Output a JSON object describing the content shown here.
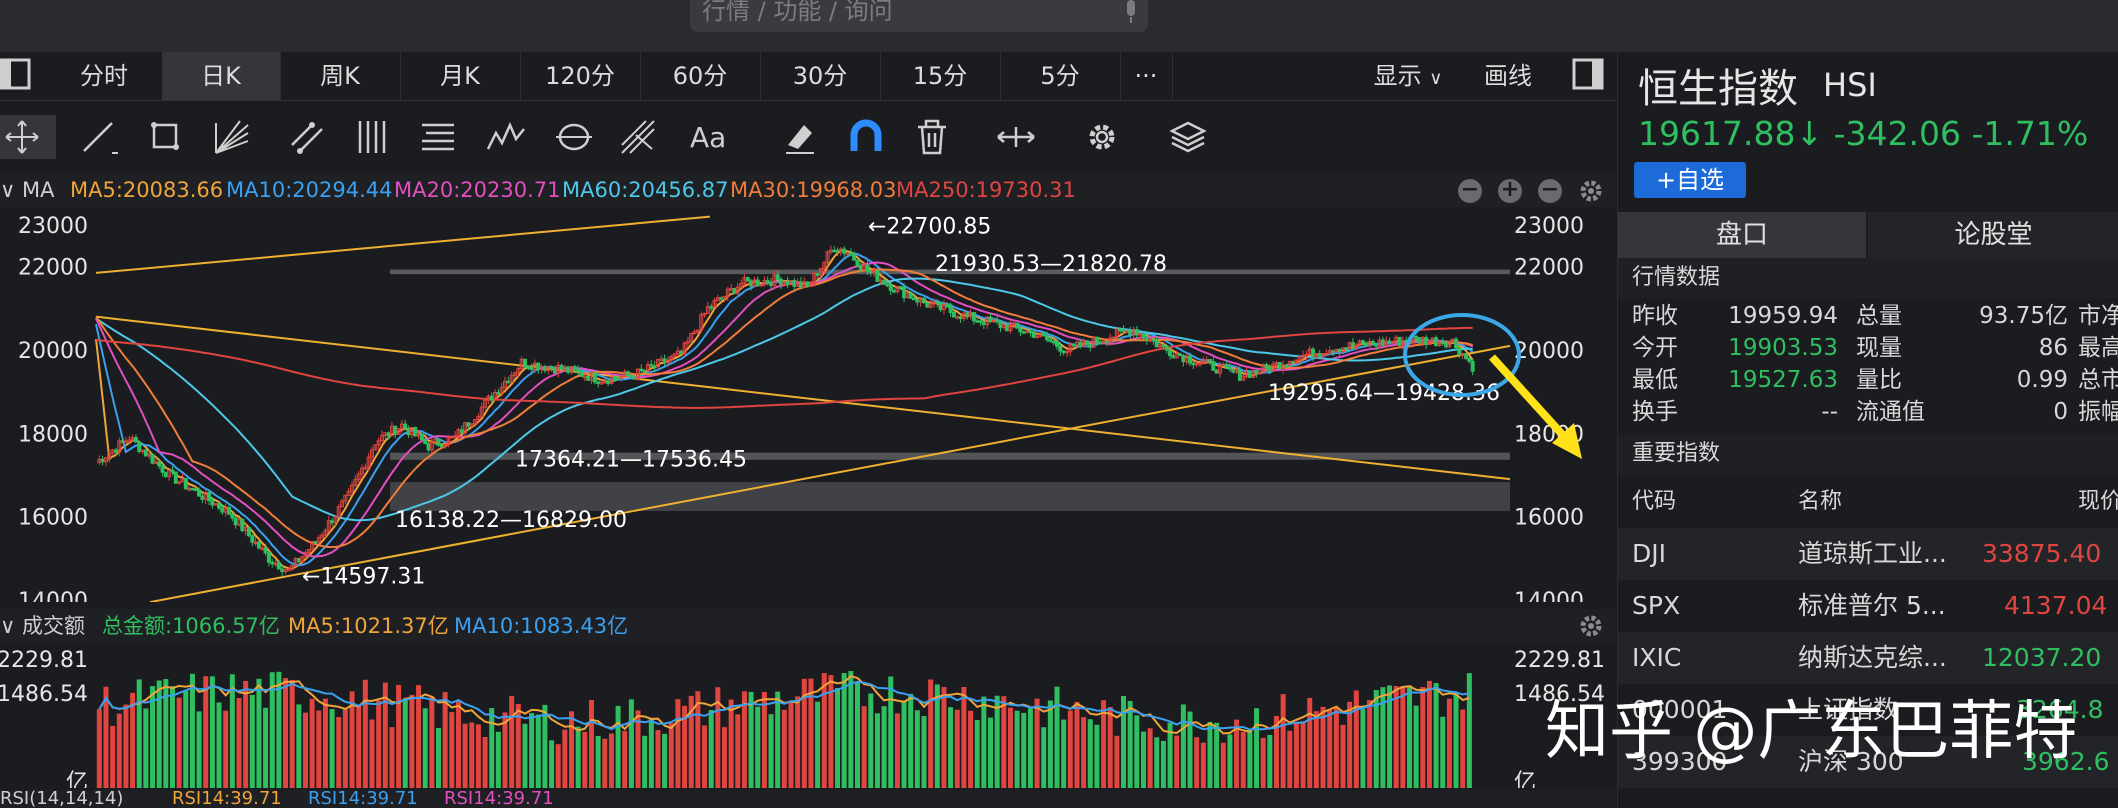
{
  "search": {
    "placeholder": "行情 / 功能 / 询问"
  },
  "tabs": [
    {
      "label": "分时",
      "active": false
    },
    {
      "label": "日K",
      "active": true
    },
    {
      "label": "周K",
      "active": false
    },
    {
      "label": "月K",
      "active": false
    },
    {
      "label": "120分",
      "active": false
    },
    {
      "label": "60分",
      "active": false
    },
    {
      "label": "30分",
      "active": false
    },
    {
      "label": "15分",
      "active": false
    },
    {
      "label": "5分",
      "active": false
    },
    {
      "label": "···",
      "active": false
    }
  ],
  "tabs_right": {
    "display": "显示",
    "draw": "画线"
  },
  "tools": [
    "move-icon",
    "line-icon",
    "rectangle-icon",
    "fan-icon",
    "channel-icon",
    "parallel-lines-icon",
    "fibonacci-icon",
    "wave-icon",
    "cycle-icon",
    "pitchfork-icon",
    "text-icon",
    "eraser-icon",
    "magnet-icon",
    "trash-icon",
    "arrows-icon",
    "settings-icon",
    "layers-icon"
  ],
  "ma": {
    "label": "MA",
    "items": [
      {
        "text": "MA5:20083.66",
        "color": "#f0a43a"
      },
      {
        "text": "MA10:20294.44",
        "color": "#3aa0f0"
      },
      {
        "text": "MA20:20230.71",
        "color": "#e24fc0"
      },
      {
        "text": "MA60:20456.87",
        "color": "#4cc8e8"
      },
      {
        "text": "MA30:19968.03",
        "color": "#f07d3a"
      },
      {
        "text": "MA250:19730.31",
        "color": "#e0453f"
      }
    ]
  },
  "chart_data": {
    "type": "candlestick",
    "y_ticks_left": [
      "23000",
      "22000",
      "20000",
      "18000",
      "16000",
      "14000"
    ],
    "y_ticks_right": [
      "23000",
      "22000",
      "20000",
      "18000",
      "16000",
      "14000"
    ],
    "annotations": [
      {
        "text": "←22700.85"
      },
      {
        "text": "21930.53—21820.78"
      },
      {
        "text": "17364.21—17536.45"
      },
      {
        "text": "16138.22—16829.00"
      },
      {
        "text": "←14597.31"
      },
      {
        "text": "19295.64—19428.36"
      }
    ],
    "ylim": [
      14000,
      23000
    ]
  },
  "volume": {
    "label": "成交额",
    "total": "总金额:1066.57亿",
    "ma5": "MA5:1021.37亿",
    "ma10": "MA10:1083.43亿",
    "ticks_left": [
      "2229.81",
      "1486.54",
      "亿"
    ],
    "ticks_right": [
      "2229.81",
      "1486.54",
      "亿"
    ]
  },
  "rsi": {
    "label": "RSI(14,14,14)",
    "r1": "RSI14:39.71",
    "r2": "RSI14:39.71",
    "r3": "RSI14:39.71"
  },
  "quote": {
    "name": "恒生指数",
    "code": "HSI",
    "price": "19617.88↓ -342.06 -1.71%",
    "add_label": "+自选",
    "tab1": "盘口",
    "tab2": "论股堂",
    "section_market": "行情数据",
    "section_index": "重要指数",
    "rows": [
      [
        {
          "t": "昨收",
          "c": "#d9d9d9"
        },
        {
          "t": "19959.94",
          "c": "#d9d9d9"
        },
        {
          "t": "总量",
          "c": "#d9d9d9"
        },
        {
          "t": "93.75亿",
          "c": "#d9d9d9"
        },
        {
          "t": "市净",
          "c": "#d9d9d9"
        }
      ],
      [
        {
          "t": "今开",
          "c": "#d9d9d9"
        },
        {
          "t": "19903.53",
          "c": "#2fbf60"
        },
        {
          "t": "现量",
          "c": "#d9d9d9"
        },
        {
          "t": "86",
          "c": "#d9d9d9"
        },
        {
          "t": "最高",
          "c": "#d9d9d9"
        }
      ],
      [
        {
          "t": "最低",
          "c": "#d9d9d9"
        },
        {
          "t": "19527.63",
          "c": "#2fbf60"
        },
        {
          "t": "量比",
          "c": "#d9d9d9"
        },
        {
          "t": "0.99",
          "c": "#d9d9d9"
        },
        {
          "t": "总市",
          "c": "#d9d9d9"
        }
      ],
      [
        {
          "t": "换手",
          "c": "#d9d9d9"
        },
        {
          "t": "--",
          "c": "#d9d9d9"
        },
        {
          "t": "流通值",
          "c": "#d9d9d9"
        },
        {
          "t": "0",
          "c": "#d9d9d9"
        },
        {
          "t": "振幅",
          "c": "#d9d9d9"
        }
      ]
    ],
    "index_header": {
      "code": "代码",
      "name": "名称",
      "price": "现价"
    },
    "indices": [
      {
        "code": "DJI",
        "name": "道琼斯工业...",
        "price": "33875.40",
        "color": "#e0453f"
      },
      {
        "code": "SPX",
        "name": "标准普尔 5...",
        "price": "4137.04",
        "color": "#e0453f"
      },
      {
        "code": "IXIC",
        "name": "纳斯达克综...",
        "price": "12037.20",
        "color": "#2fbf60"
      },
      {
        "code": "000001",
        "name": "上证指数",
        "price": "3264.8",
        "color": "#2fbf60"
      },
      {
        "code": "399300",
        "name": "沪深 300",
        "price": "3962.6",
        "color": "#2fbf60"
      }
    ]
  },
  "watermark": "知乎 @广东巴菲特"
}
